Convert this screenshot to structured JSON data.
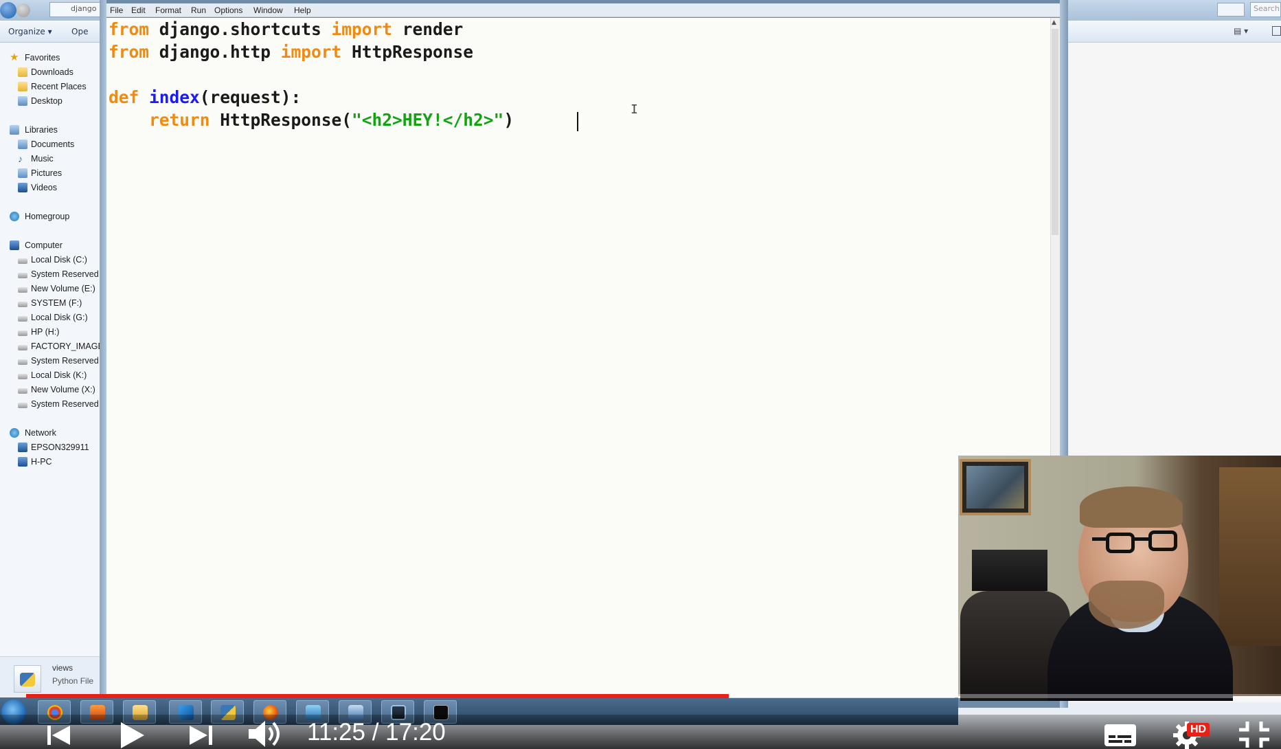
{
  "explorer": {
    "path_text": "django",
    "search_placeholder": "Search",
    "toolbar": {
      "organize": "Organize ▾",
      "open": "Ope"
    },
    "nav": {
      "favorites": "Favorites",
      "favorites_items": [
        "Downloads",
        "Recent Places",
        "Desktop"
      ],
      "libraries": "Libraries",
      "libraries_items": [
        "Documents",
        "Music",
        "Pictures",
        "Videos"
      ],
      "homegroup": "Homegroup",
      "computer": "Computer",
      "computer_items": [
        "Local Disk (C:)",
        "System Reserved (D",
        "New Volume (E:)",
        "SYSTEM (F:)",
        "Local Disk (G:)",
        "HP (H:)",
        "FACTORY_IMAGE (",
        "System Reserved (J",
        "Local Disk (K:)",
        "New Volume (X:)",
        "System Reserved (Z"
      ],
      "network": "Network",
      "network_items": [
        "EPSON329911",
        "H-PC"
      ]
    },
    "details": {
      "name": "views",
      "type": "Python File"
    }
  },
  "editor": {
    "menu": [
      "File",
      "Edit",
      "Format",
      "Run",
      "Options",
      "Window",
      "Help"
    ],
    "code": {
      "line1": {
        "kw1": "from",
        "t1": " django.shortcuts ",
        "kw2": "import",
        "t2": " render"
      },
      "line2": {
        "kw1": "from",
        "t1": " django.http ",
        "kw2": "import",
        "t2": " HttpResponse"
      },
      "line4": {
        "kw1": "def",
        "sp": " ",
        "fn": "index",
        "t1": "(request):"
      },
      "line5": {
        "indent": "    ",
        "kw1": "return",
        "t1": " HttpResponse(",
        "str": "\"<h2>HEY!</h2>\"",
        "t2": ")"
      }
    }
  },
  "player": {
    "current_time": "11:25",
    "duration": "17:20",
    "time_text": "11:25 / 17:20",
    "progress_played": 0.56,
    "progress_loaded": 0.74,
    "hd_label": "HD"
  },
  "colors": {
    "keyword": "#f08a10",
    "function": "#1a1aff",
    "string": "#12a312",
    "progress": "#e62117"
  }
}
